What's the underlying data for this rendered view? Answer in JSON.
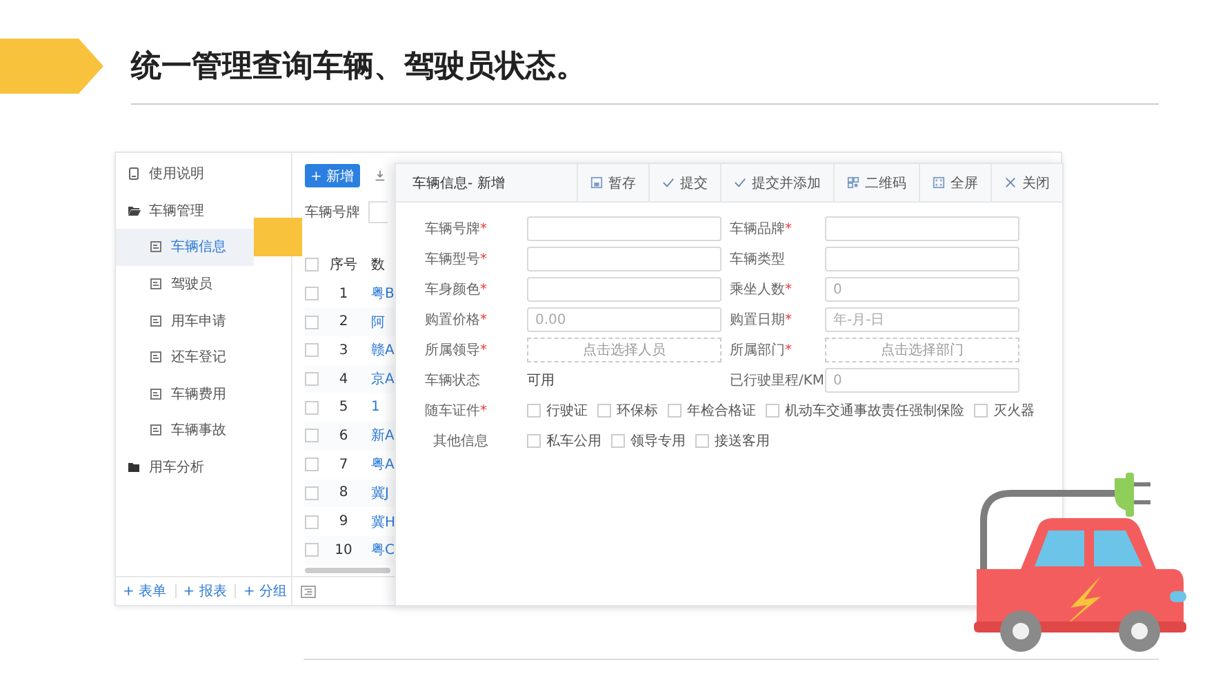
{
  "slide": {
    "title": "统一管理查询车辆、驾驶员状态。"
  },
  "sidebar": {
    "items": [
      {
        "label": "使用说明",
        "kind": "page",
        "selected": false
      },
      {
        "label": "车辆管理",
        "kind": "group",
        "expanded": true,
        "selected": false,
        "children": [
          {
            "label": "车辆信息",
            "kind": "form",
            "selected": true
          },
          {
            "label": "驾驶员",
            "kind": "form",
            "selected": false
          },
          {
            "label": "用车申请",
            "kind": "form",
            "selected": false
          },
          {
            "label": "还车登记",
            "kind": "form",
            "selected": false
          },
          {
            "label": "车辆费用",
            "kind": "form",
            "selected": false
          },
          {
            "label": "车辆事故",
            "kind": "form",
            "selected": false
          }
        ]
      },
      {
        "label": "用车分析",
        "kind": "group",
        "expanded": false,
        "selected": false
      }
    ],
    "footer_actions": [
      "+ 表单",
      "+ 报表",
      "+ 分组"
    ]
  },
  "list": {
    "add_button": "+ 新增",
    "filter_label": "车辆号牌",
    "header_checked": false,
    "columns": [
      "序号",
      "数"
    ],
    "rows": [
      {
        "index": "1",
        "plate": "粤B",
        "checked": false
      },
      {
        "index": "2",
        "plate": "阿",
        "checked": false
      },
      {
        "index": "3",
        "plate": "赣A",
        "checked": false
      },
      {
        "index": "4",
        "plate": "京A",
        "checked": false
      },
      {
        "index": "5",
        "plate": "1",
        "checked": false
      },
      {
        "index": "6",
        "plate": "新A",
        "checked": false
      },
      {
        "index": "7",
        "plate": "粤A",
        "checked": false
      },
      {
        "index": "8",
        "plate": "冀J",
        "checked": false
      },
      {
        "index": "9",
        "plate": "冀H",
        "checked": false
      },
      {
        "index": "10",
        "plate": "粤C",
        "checked": false
      }
    ]
  },
  "dialog": {
    "title": "车辆信息- 新增",
    "actions": [
      {
        "label": "暂存",
        "kind": "save"
      },
      {
        "label": "提交",
        "kind": "check"
      },
      {
        "label": "提交并添加",
        "kind": "check"
      },
      {
        "label": "二维码",
        "kind": "qr"
      },
      {
        "label": "全屏",
        "kind": "fullscreen"
      },
      {
        "label": "关闭",
        "kind": "close"
      }
    ],
    "fields": [
      {
        "label": "车辆号牌",
        "mark": "*",
        "kind": "input"
      },
      {
        "label": "车辆品牌",
        "mark": "*",
        "kind": "input"
      },
      {
        "label": "车辆型号",
        "mark": "*",
        "kind": "input"
      },
      {
        "label": "车辆类型",
        "kind": "input"
      },
      {
        "label": "车身颜色",
        "mark": "*",
        "kind": "input"
      },
      {
        "label": "乘坐人数",
        "mark": "*",
        "kind": "input",
        "placeholder": "0"
      },
      {
        "label": "购置价格",
        "mark": "*",
        "kind": "input",
        "placeholder": "0.00"
      },
      {
        "label": "购置日期",
        "mark": "*",
        "kind": "input",
        "placeholder": "年-月-日"
      },
      {
        "label": "所属领导",
        "mark": "*",
        "kind": "picker",
        "placeholder": "点击选择人员"
      },
      {
        "label": "所属部门",
        "mark": "*",
        "kind": "picker",
        "placeholder": "点击选择部门"
      },
      {
        "label": "车辆状态",
        "kind": "text",
        "value": "可用"
      },
      {
        "label": "已行驶里程/KM",
        "kind": "input",
        "placeholder": "0"
      }
    ],
    "checkbox_groups": [
      {
        "label": "随车证件",
        "mark": "*",
        "options": [
          {
            "label": "行驶证",
            "checked": false
          },
          {
            "label": "环保标",
            "checked": false
          },
          {
            "label": "年检合格证",
            "checked": false
          },
          {
            "label": "机动车交通事故责任强制保险",
            "checked": false
          },
          {
            "label": "灭火器",
            "checked": false
          }
        ]
      },
      {
        "label": "其他信息",
        "options": [
          {
            "label": "私车公用",
            "checked": false
          },
          {
            "label": "领导专用",
            "checked": false
          },
          {
            "label": "接送客用",
            "checked": false
          }
        ]
      }
    ]
  }
}
